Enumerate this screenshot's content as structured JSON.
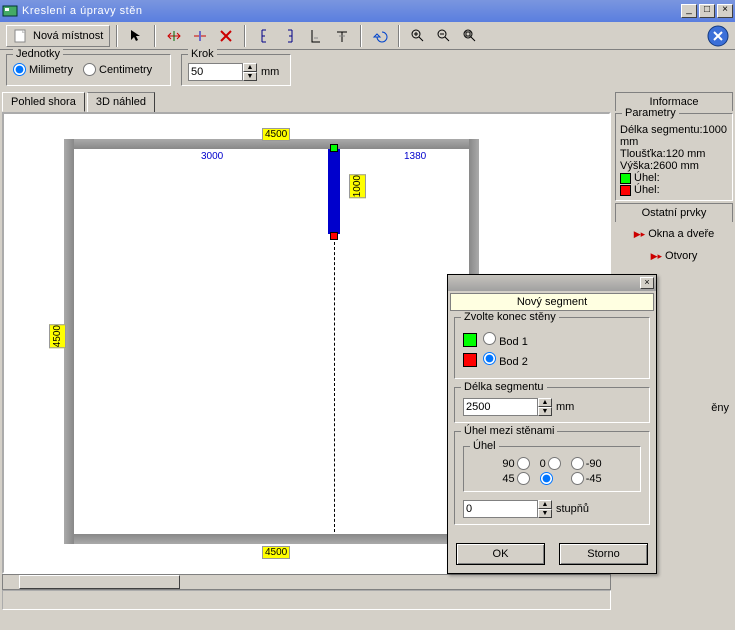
{
  "window": {
    "title": "Kreslení a úpravy stěn"
  },
  "toolbar": {
    "newRoom": "Nová místnost"
  },
  "units": {
    "legend": "Jednotky",
    "mm": "Milimetry",
    "cm": "Centimetry",
    "selected": "mm"
  },
  "step": {
    "legend": "Krok",
    "value": "50",
    "unit": "mm"
  },
  "tabs": {
    "top": "Pohled shora",
    "three": "3D náhled"
  },
  "drawing": {
    "dimTop": "4500",
    "dimBottom": "4500",
    "dimLeftV": "4500",
    "dimSeg1": "3000",
    "dimSeg2": "1380",
    "dimBlueV": "1000"
  },
  "info": {
    "title": "Informace",
    "paramsLegend": "Parametry",
    "lenLabel": "Délka segmentu:",
    "lenVal": "1000 mm",
    "thickLabel": "Tloušťka:",
    "thickVal": "120 mm",
    "heightLabel": "Výška:",
    "heightVal": "2600 mm",
    "angleLabel": "Úhel:",
    "otherTitle": "Ostatní prvky",
    "windowsDoors": "Okna a dveře",
    "openings": "Otvory",
    "otherWallsLabel": "ěny"
  },
  "dialog": {
    "title": "Nový segment",
    "endLegend": "Zvolte konec stěny",
    "pt1": "Bod 1",
    "pt2": "Bod 2",
    "lenLegend": "Délka segmentu",
    "lenValue": "2500",
    "lenUnit": "mm",
    "angleLegend": "Úhel mezi stěnami",
    "angleSubLegend": "Úhel",
    "a90": "90",
    "a0": "0",
    "aNeg90": "-90",
    "a45": "45",
    "aNeg45": "-45",
    "customAngle": "0",
    "degUnit": "stupňů",
    "ok": "OK",
    "cancel": "Storno"
  },
  "colors": {
    "green": "#00ff00",
    "red": "#ff0000"
  }
}
